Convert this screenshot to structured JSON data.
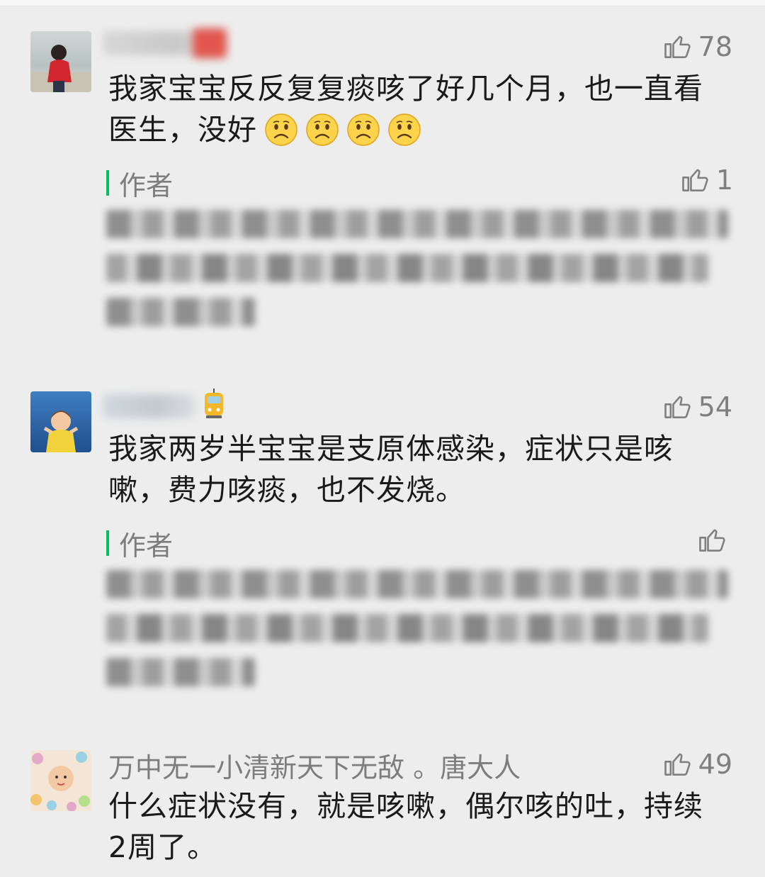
{
  "comments": [
    {
      "likes": "78",
      "text": "我家宝宝反反复复痰咳了好几个月，也一直看医生，没好",
      "emoji_count": 4,
      "reply": {
        "author_label": "作者",
        "likes": "1"
      }
    },
    {
      "likes": "54",
      "text": "我家两岁半宝宝是支原体感染，症状只是咳嗽，费力咳痰，也不发烧。",
      "reply": {
        "author_label": "作者",
        "likes": ""
      }
    },
    {
      "nickname": "万中无一小清新天下无敌 。唐大人",
      "likes": "49",
      "text": "什么症状没有，就是咳嗽，偶尔咳的吐，持续2周了。"
    }
  ],
  "icons": {
    "like": "thumbs-up-outline-icon",
    "sad": "frowning-face-emoji",
    "tram": "tram-emoji"
  },
  "colors": {
    "author_accent": "#07c160",
    "meta_text": "#7d7d7d",
    "background": "#ededed"
  }
}
